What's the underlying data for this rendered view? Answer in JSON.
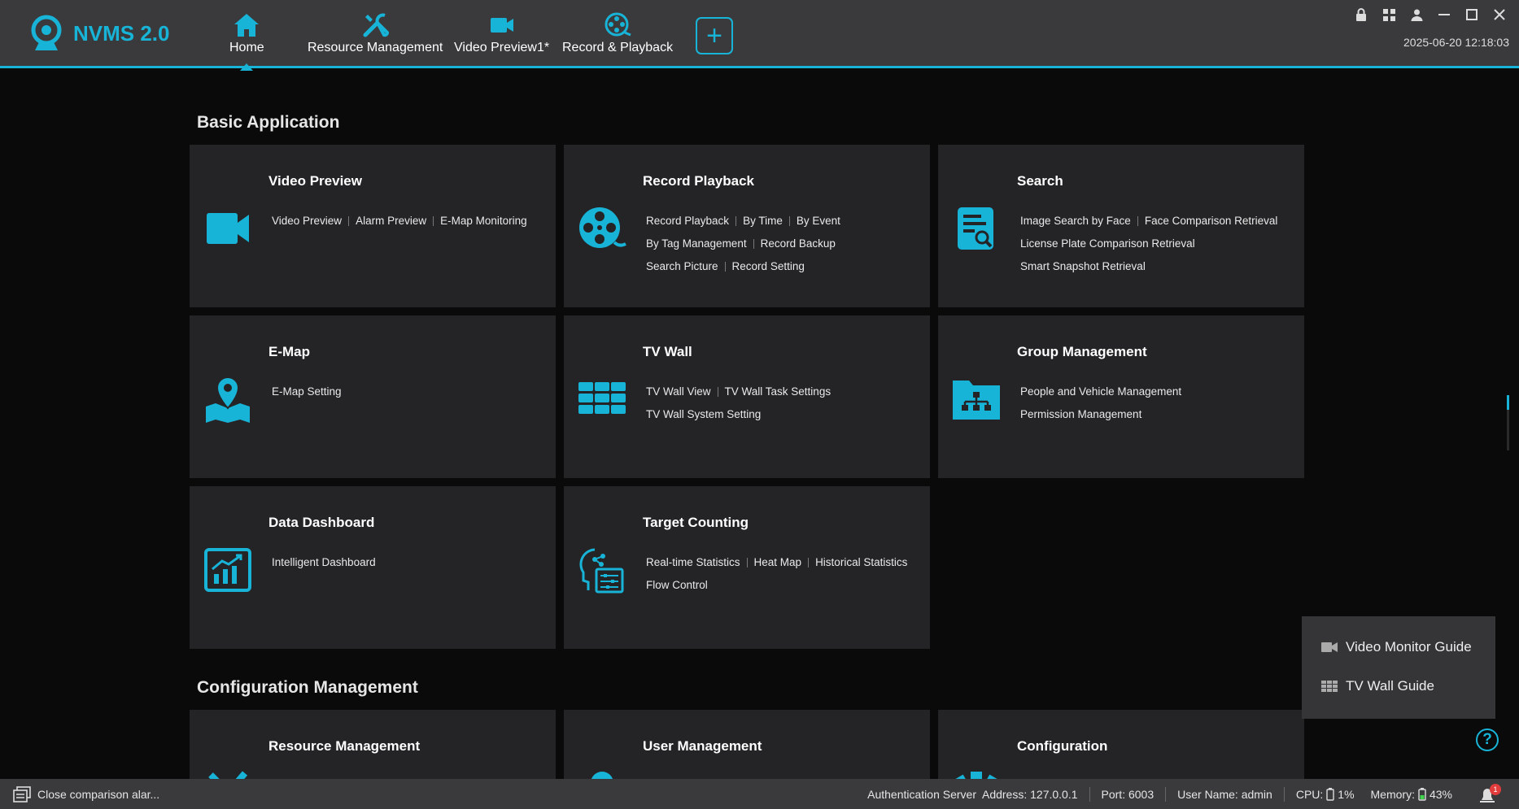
{
  "app": {
    "title": "NVMS 2.0",
    "datetime": "2025-06-20 12:18:03"
  },
  "nav": {
    "home": "Home",
    "resource": "Resource Management",
    "preview": "Video Preview1*",
    "playback": "Record & Playback",
    "add": "+"
  },
  "sections": {
    "basic": "Basic Application",
    "config": "Configuration Management"
  },
  "cards": {
    "video_preview": {
      "title": "Video Preview",
      "links": [
        "Video Preview",
        "Alarm Preview",
        "E-Map Monitoring"
      ]
    },
    "record_playback": {
      "title": "Record  Playback",
      "links": [
        "Record Playback",
        "By Time",
        "By Event",
        "By Tag Management",
        "Record Backup",
        "Search Picture",
        "Record Setting"
      ]
    },
    "search": {
      "title": "Search",
      "links": [
        "Image Search by Face",
        "Face Comparison Retrieval",
        "License Plate Comparison Retrieval",
        "Smart Snapshot Retrieval"
      ]
    },
    "emap": {
      "title": "E-Map",
      "links": [
        "E-Map Setting"
      ]
    },
    "tvwall": {
      "title": "TV Wall",
      "links": [
        "TV Wall View",
        "TV Wall Task Settings",
        "TV Wall System Setting"
      ]
    },
    "group": {
      "title": "Group Management",
      "links": [
        "People and Vehicle Management",
        "Permission Management"
      ]
    },
    "dashboard": {
      "title": "Data Dashboard",
      "links": [
        "Intelligent Dashboard"
      ]
    },
    "counting": {
      "title": "Target Counting",
      "links": [
        "Real-time Statistics",
        "Heat Map",
        "Historical Statistics",
        "Flow Control"
      ]
    },
    "resource_mgmt": {
      "title": "Resource Management"
    },
    "user_mgmt": {
      "title": "User Management"
    },
    "configuration": {
      "title": "Configuration"
    }
  },
  "guide": {
    "video_monitor": "Video Monitor Guide",
    "tv_wall": "TV Wall Guide",
    "help": "?"
  },
  "status": {
    "left": "Close comparison alar...",
    "auth": "Authentication Server  Address: 127.0.0.1",
    "port": "Port: 6003",
    "user": "User Name: admin",
    "cpu_label": "CPU:",
    "cpu": "1%",
    "memory_label": "Memory:",
    "memory": "43%",
    "alarm_count": "1"
  },
  "colors": {
    "accent": "#18b4d8",
    "card_bg": "#242427",
    "bar_bg": "#3a3a3c"
  }
}
